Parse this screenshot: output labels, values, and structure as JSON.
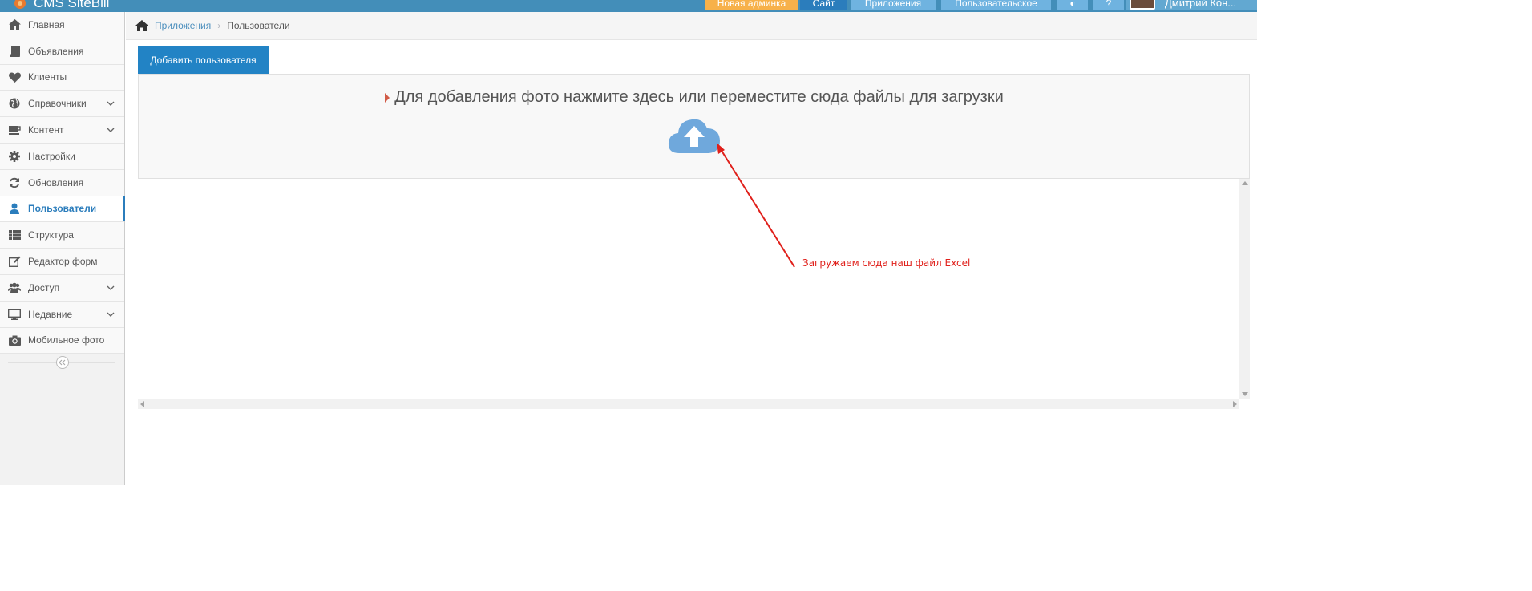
{
  "navbar": {
    "brand": "CMS SiteBill",
    "buttons": [
      "Новая админка",
      "Сайт",
      "Приложения",
      "Пользовательское"
    ],
    "user_name": "Дмитрий Кон..."
  },
  "sidebar": {
    "items": [
      {
        "label": "Главная",
        "icon": "home-icon",
        "has_submenu": false
      },
      {
        "label": "Объявления",
        "icon": "book-icon",
        "has_submenu": false
      },
      {
        "label": "Клиенты",
        "icon": "heart-icon",
        "has_submenu": false
      },
      {
        "label": "Справочники",
        "icon": "globe-icon",
        "has_submenu": true
      },
      {
        "label": "Контент",
        "icon": "coffee-icon",
        "has_submenu": true
      },
      {
        "label": "Настройки",
        "icon": "gear-icon",
        "has_submenu": false
      },
      {
        "label": "Обновления",
        "icon": "refresh-icon",
        "has_submenu": false
      },
      {
        "label": "Пользователи",
        "icon": "user-icon",
        "has_submenu": false,
        "active": true
      },
      {
        "label": "Структура",
        "icon": "list-icon",
        "has_submenu": false
      },
      {
        "label": "Редактор форм",
        "icon": "edit-icon",
        "has_submenu": false
      },
      {
        "label": "Доступ",
        "icon": "users-icon",
        "has_submenu": true
      },
      {
        "label": "Недавние",
        "icon": "desktop-icon",
        "has_submenu": true
      },
      {
        "label": "Мобильное фото",
        "icon": "camera-icon",
        "has_submenu": false
      }
    ]
  },
  "breadcrumbs": {
    "items": [
      "Приложения",
      "Пользователи"
    ]
  },
  "main": {
    "add_button_label": "Добавить пользователя",
    "dropzone_text": "Для добавления фото нажмите здесь или переместите сюда файлы для загрузки"
  },
  "annotation": {
    "text": "Загружаем сюда наш файл Excel",
    "color": "#e0201b"
  },
  "colors": {
    "navbar": "#438eb9",
    "primary_button": "#2283c5",
    "active_item": "#2b7dbc",
    "cloud_icon": "#6fa8dc"
  }
}
